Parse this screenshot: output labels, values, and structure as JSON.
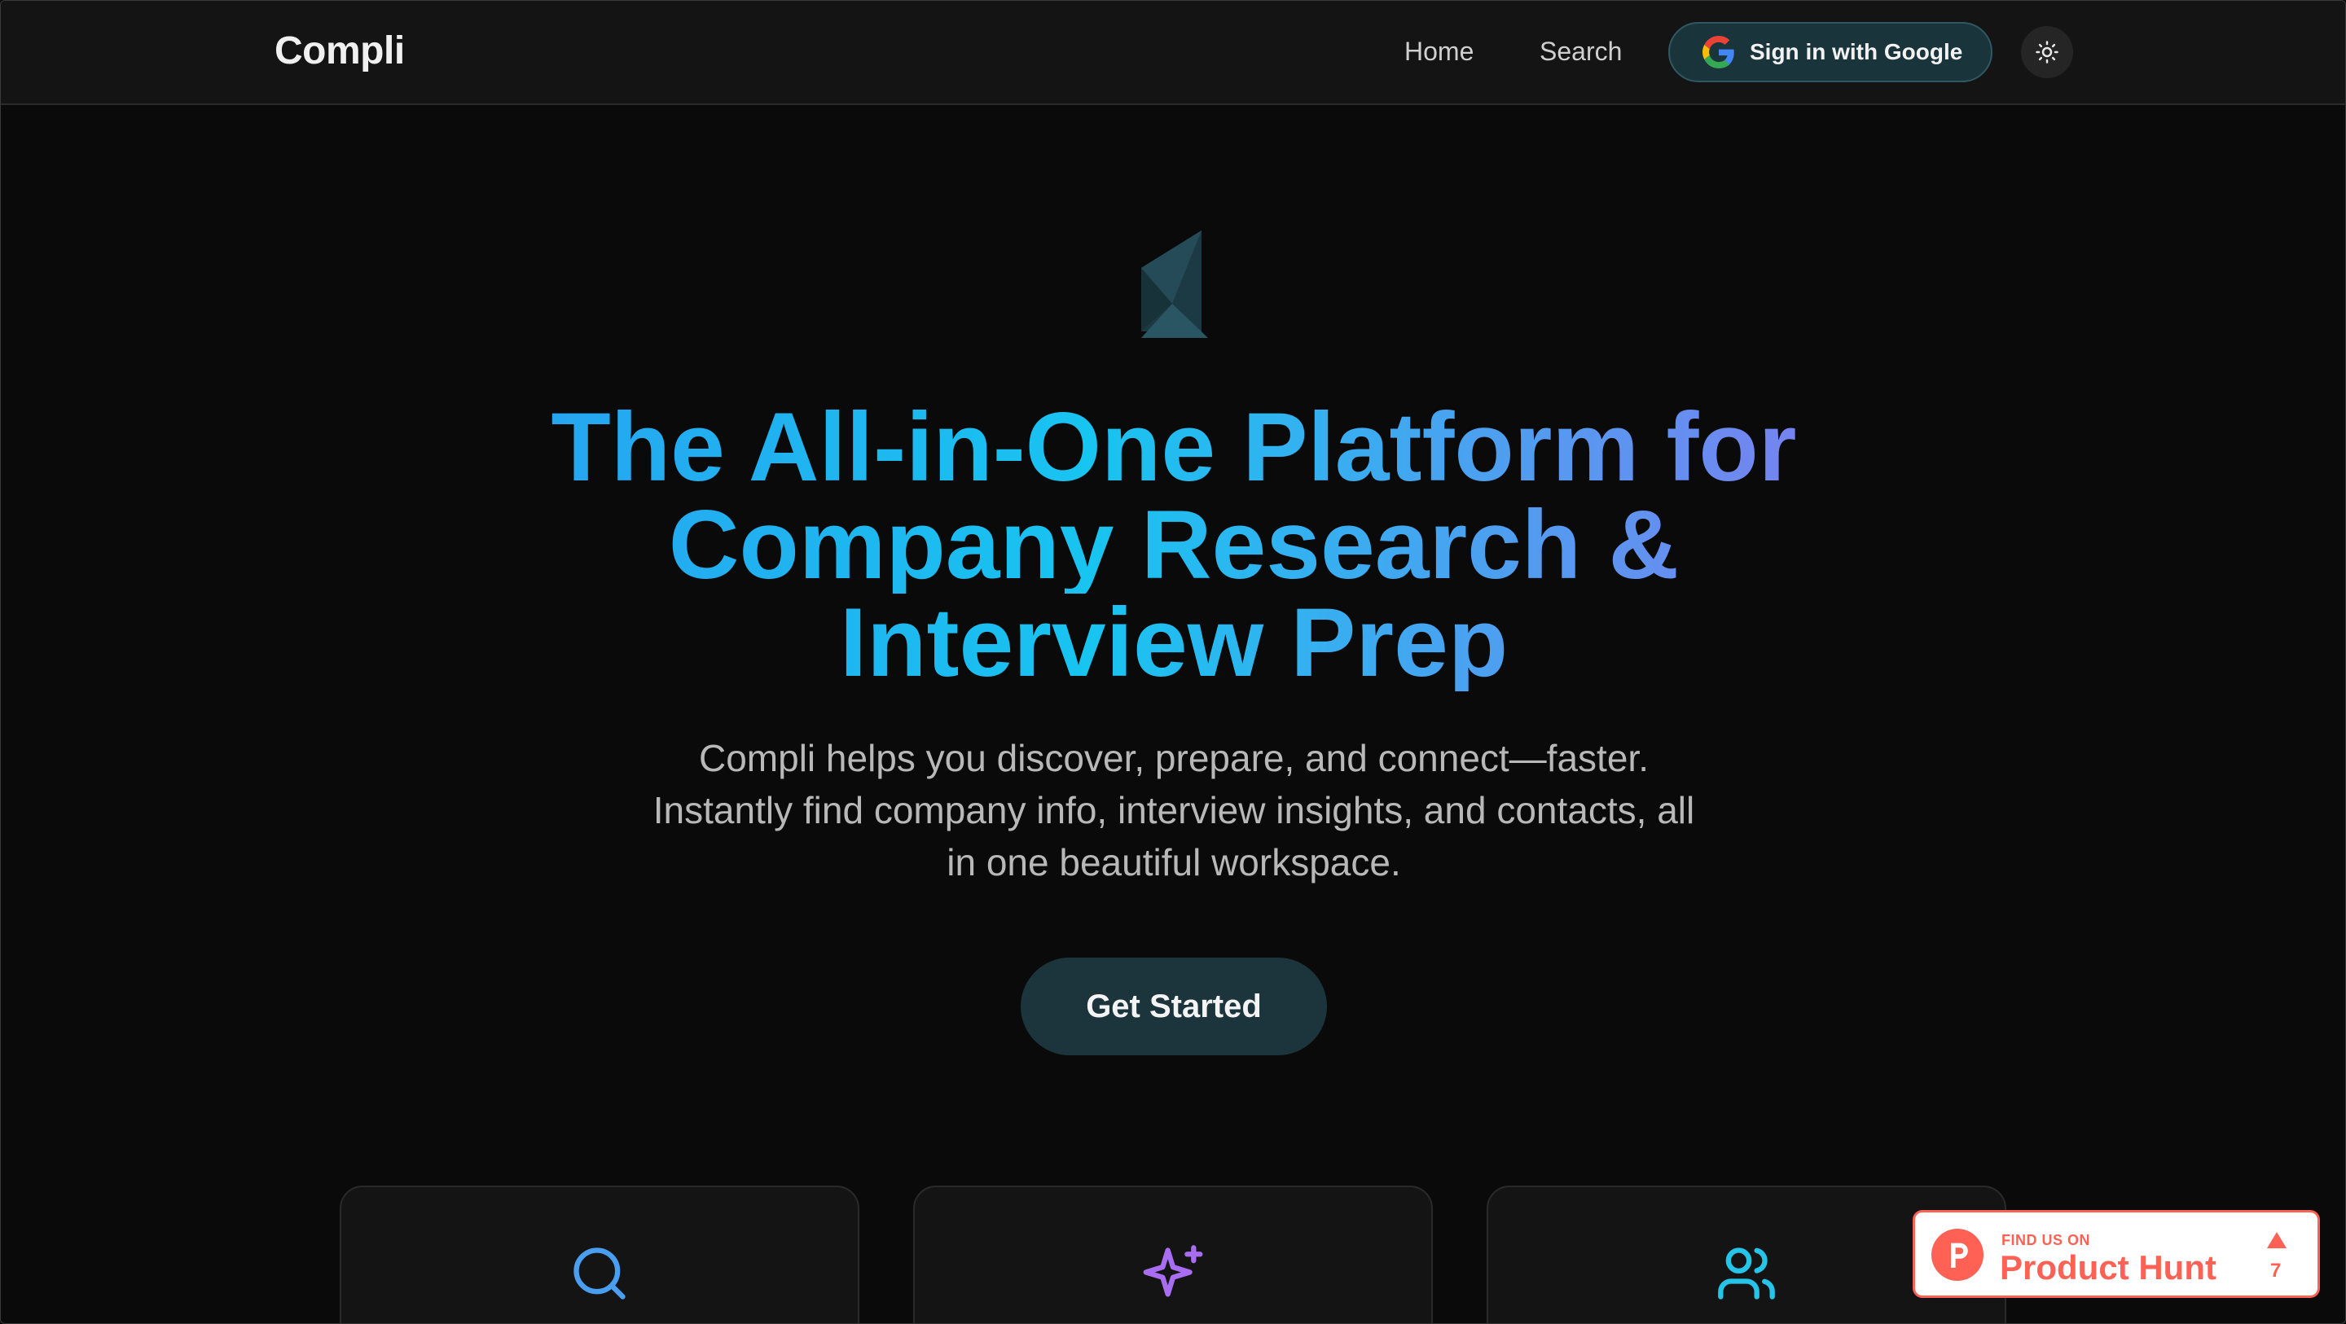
{
  "header": {
    "brand": "Compli",
    "nav": {
      "home": "Home",
      "search": "Search"
    },
    "sign_in_label": "Sign in with Google",
    "theme_toggle_icon": "sun-icon"
  },
  "hero": {
    "logo_icon": "compli-logo-icon",
    "headline_lines": [
      "The All-in-One Platform for",
      "Company Research &",
      "Interview Prep"
    ],
    "subtext_lines": [
      "Compli helps you discover, prepare, and connect—faster.",
      "Instantly find company info, interview insights, and contacts, all",
      "in one beautiful workspace."
    ],
    "cta_label": "Get Started"
  },
  "features": [
    {
      "icon": "search-icon",
      "color": "#4a9ef0"
    },
    {
      "icon": "sparkles-icon",
      "color": "#a86df0"
    },
    {
      "icon": "users-icon",
      "color": "#25c4e8"
    }
  ],
  "product_hunt": {
    "find_label": "FIND US ON",
    "name": "Product Hunt",
    "upvotes": "7",
    "color": "#ff6154"
  },
  "colors": {
    "background": "#0a0a0a",
    "header_bg": "#141414",
    "button_bg": "#1c353c",
    "headline_gradient": [
      "#2b9bf0",
      "#18c4f0",
      "#8f72f0"
    ]
  }
}
